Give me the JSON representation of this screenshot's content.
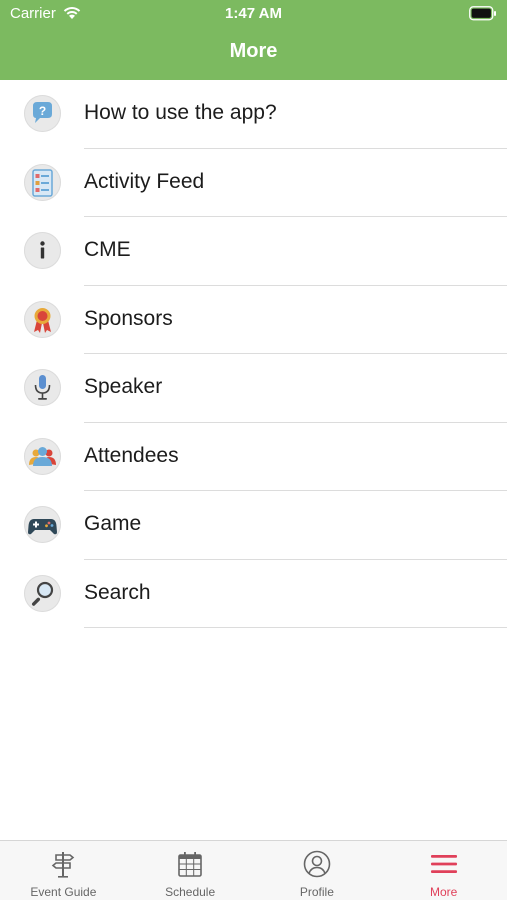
{
  "status_bar": {
    "carrier": "Carrier",
    "time": "1:47 AM"
  },
  "header": {
    "title": "More"
  },
  "colors": {
    "header_bg": "#7cba60",
    "active_tab": "#e0405a"
  },
  "menu": {
    "items": [
      {
        "label": "How to use the app?",
        "icon": "help-bubble-icon"
      },
      {
        "label": "Activity Feed",
        "icon": "activity-list-icon"
      },
      {
        "label": "CME",
        "icon": "info-icon"
      },
      {
        "label": "Sponsors",
        "icon": "award-ribbon-icon"
      },
      {
        "label": "Speaker",
        "icon": "microphone-icon"
      },
      {
        "label": "Attendees",
        "icon": "people-group-icon"
      },
      {
        "label": "Game",
        "icon": "gamepad-icon"
      },
      {
        "label": "Search",
        "icon": "magnifier-icon"
      }
    ]
  },
  "tabbar": {
    "tabs": [
      {
        "label": "Event Guide",
        "icon": "signpost-icon",
        "active": false
      },
      {
        "label": "Schedule",
        "icon": "calendar-icon",
        "active": false
      },
      {
        "label": "Profile",
        "icon": "user-icon",
        "active": false
      },
      {
        "label": "More",
        "icon": "menu-icon",
        "active": true
      }
    ]
  }
}
